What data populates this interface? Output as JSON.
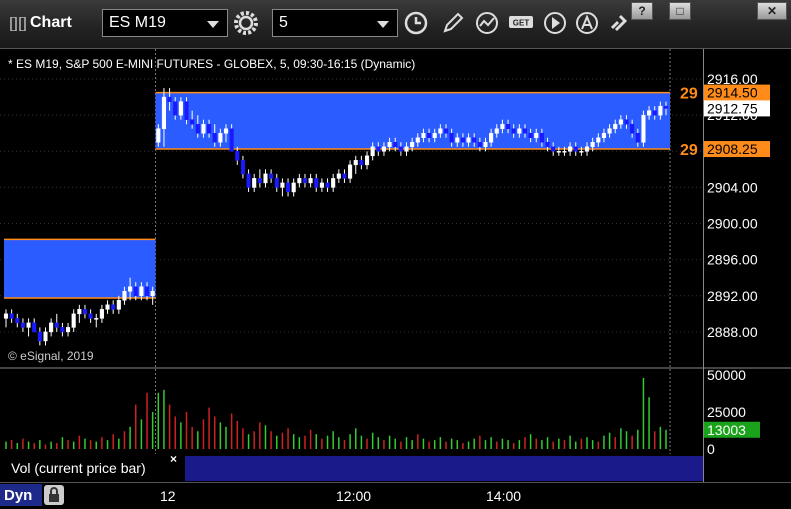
{
  "toolbar": {
    "title": "Chart",
    "symbol": "ES M19",
    "interval": "5"
  },
  "window_buttons": [
    "?",
    "□",
    "✕"
  ],
  "chart_header": "* ES M19, S&P 500 E-MINI FUTURES - GLOBEX, 5, 09:30-16:15 (Dynamic)",
  "copyright": "© eSignal, 2019",
  "price_labels": [
    {
      "value": 2914.5,
      "text": "2914.50",
      "bg": "#ff8c1a",
      "fg": "#000"
    },
    {
      "value": 2912.75,
      "text": "2912.75",
      "bg": "#ffffff",
      "fg": "#000"
    },
    {
      "value": 2908.25,
      "text": "2908.25",
      "bg": "#ff8c1a",
      "fg": "#000"
    }
  ],
  "level_tags": [
    "29",
    "29"
  ],
  "volume_label": {
    "text": "13003",
    "bg": "#1aa31a"
  },
  "vol_pane_label": "Vol (current price bar)",
  "vol_close": "×",
  "dyn_label": "Dyn",
  "time_labels": [
    "12",
    "12:00",
    "14:00"
  ],
  "colors": {
    "zone": "#2a5cff",
    "level_line": "#ff8c1a",
    "candle_up": "#ffffff",
    "candle_down": "#1a1aff",
    "vol_up": "#33cc33",
    "vol_down": "#cc2222"
  },
  "chart_data": {
    "type": "candlestick",
    "ylim": [
      2885,
      2918
    ],
    "yticks": [
      "2916.00",
      "2912.00",
      "2908.00",
      "2904.00",
      "2900.00",
      "2896.00",
      "2892.00",
      "2888.00"
    ],
    "ytick_values": [
      2916,
      2912,
      2908,
      2904,
      2900,
      2896,
      2892,
      2888
    ],
    "zones": [
      {
        "from_index": 0,
        "to_index": 27,
        "low": 2891.75,
        "high": 2898.25
      },
      {
        "from_index": 27,
        "to_index": 127,
        "low": 2908.25,
        "high": 2914.5
      }
    ],
    "vol_ylim": [
      0,
      50000
    ],
    "vol_yticks": [
      "50000",
      "25000",
      "0"
    ],
    "vol_ytick_values": [
      50000,
      25000,
      0
    ],
    "session_break_index": 27,
    "candles": [
      [
        2889.5,
        2890.5,
        2888.5,
        2890.0
      ],
      [
        2890.0,
        2890.5,
        2889.0,
        2889.5
      ],
      [
        2889.5,
        2890.0,
        2888.5,
        2889.0
      ],
      [
        2889.0,
        2889.5,
        2888.0,
        2888.5
      ],
      [
        2888.5,
        2889.5,
        2887.5,
        2889.0
      ],
      [
        2889.0,
        2889.5,
        2888.0,
        2888.0
      ],
      [
        2888.0,
        2888.5,
        2886.5,
        2887.0
      ],
      [
        2887.0,
        2888.5,
        2886.5,
        2888.0
      ],
      [
        2888.0,
        2889.5,
        2887.5,
        2889.0
      ],
      [
        2889.0,
        2890.0,
        2888.0,
        2888.5
      ],
      [
        2888.5,
        2889.0,
        2887.5,
        2888.0
      ],
      [
        2888.0,
        2889.0,
        2887.5,
        2888.5
      ],
      [
        2888.5,
        2890.5,
        2888.0,
        2890.0
      ],
      [
        2890.0,
        2891.0,
        2889.0,
        2890.5
      ],
      [
        2890.5,
        2891.0,
        2889.5,
        2890.0
      ],
      [
        2890.0,
        2890.5,
        2889.0,
        2889.5
      ],
      [
        2889.5,
        2890.0,
        2888.5,
        2889.5
      ],
      [
        2889.5,
        2891.0,
        2889.0,
        2890.5
      ],
      [
        2890.5,
        2891.5,
        2890.0,
        2891.0
      ],
      [
        2891.0,
        2891.5,
        2890.0,
        2890.5
      ],
      [
        2890.5,
        2892.0,
        2890.0,
        2891.5
      ],
      [
        2891.5,
        2893.0,
        2891.0,
        2892.5
      ],
      [
        2892.5,
        2894.0,
        2891.5,
        2893.0
      ],
      [
        2893.0,
        2893.5,
        2891.5,
        2892.0
      ],
      [
        2892.0,
        2893.5,
        2891.5,
        2893.0
      ],
      [
        2893.0,
        2893.5,
        2891.5,
        2892.0
      ],
      [
        2892.0,
        2893.0,
        2891.0,
        2892.5
      ],
      [
        2909.0,
        2911.0,
        2908.5,
        2910.5
      ],
      [
        2910.5,
        2915.0,
        2908.5,
        2914.0
      ],
      [
        2914.0,
        2915.0,
        2912.5,
        2913.5
      ],
      [
        2913.5,
        2914.0,
        2911.5,
        2912.0
      ],
      [
        2912.0,
        2914.0,
        2911.5,
        2913.5
      ],
      [
        2913.5,
        2914.0,
        2911.0,
        2911.5
      ],
      [
        2911.5,
        2912.5,
        2910.5,
        2911.0
      ],
      [
        2911.0,
        2912.0,
        2909.5,
        2910.0
      ],
      [
        2910.0,
        2911.5,
        2909.5,
        2911.0
      ],
      [
        2911.0,
        2911.5,
        2909.5,
        2910.0
      ],
      [
        2910.0,
        2911.0,
        2908.5,
        2909.0
      ],
      [
        2909.0,
        2910.5,
        2908.5,
        2910.0
      ],
      [
        2910.0,
        2911.0,
        2909.0,
        2910.5
      ],
      [
        2910.5,
        2911.0,
        2908.0,
        2908.0
      ],
      [
        2908.0,
        2908.5,
        2906.5,
        2907.0
      ],
      [
        2907.0,
        2907.5,
        2905.0,
        2905.5
      ],
      [
        2905.5,
        2906.0,
        2903.5,
        2904.0
      ],
      [
        2904.0,
        2905.5,
        2903.5,
        2905.0
      ],
      [
        2905.0,
        2906.0,
        2904.0,
        2904.5
      ],
      [
        2904.5,
        2906.0,
        2904.0,
        2905.5
      ],
      [
        2905.5,
        2906.0,
        2904.5,
        2905.0
      ],
      [
        2905.0,
        2905.5,
        2903.5,
        2904.0
      ],
      [
        2904.0,
        2905.0,
        2903.0,
        2904.5
      ],
      [
        2904.5,
        2905.0,
        2903.0,
        2903.5
      ],
      [
        2903.5,
        2905.0,
        2903.0,
        2904.5
      ],
      [
        2904.5,
        2905.5,
        2904.0,
        2905.0
      ],
      [
        2905.0,
        2905.5,
        2904.0,
        2904.5
      ],
      [
        2904.5,
        2905.5,
        2904.0,
        2905.0
      ],
      [
        2905.0,
        2905.5,
        2903.5,
        2904.0
      ],
      [
        2904.0,
        2905.0,
        2903.5,
        2904.5
      ],
      [
        2904.5,
        2905.0,
        2903.5,
        2904.0
      ],
      [
        2904.0,
        2905.5,
        2903.5,
        2905.0
      ],
      [
        2905.0,
        2906.0,
        2904.5,
        2905.5
      ],
      [
        2905.5,
        2906.0,
        2904.5,
        2905.0
      ],
      [
        2905.0,
        2907.0,
        2904.5,
        2906.5
      ],
      [
        2906.5,
        2907.5,
        2905.5,
        2907.0
      ],
      [
        2907.0,
        2907.5,
        2906.0,
        2906.5
      ],
      [
        2906.5,
        2908.0,
        2906.0,
        2907.5
      ],
      [
        2907.5,
        2909.0,
        2907.0,
        2908.5
      ],
      [
        2908.5,
        2909.0,
        2907.5,
        2908.0
      ],
      [
        2908.0,
        2909.0,
        2907.5,
        2908.5
      ],
      [
        2908.5,
        2909.5,
        2908.0,
        2909.0
      ],
      [
        2909.0,
        2909.5,
        2908.0,
        2908.5
      ],
      [
        2908.5,
        2909.0,
        2907.5,
        2908.0
      ],
      [
        2908.0,
        2909.0,
        2907.5,
        2908.5
      ],
      [
        2908.5,
        2909.5,
        2908.0,
        2909.0
      ],
      [
        2909.0,
        2910.0,
        2908.5,
        2909.5
      ],
      [
        2909.5,
        2910.5,
        2909.0,
        2910.0
      ],
      [
        2910.0,
        2910.5,
        2909.0,
        2909.5
      ],
      [
        2909.5,
        2910.5,
        2909.0,
        2910.0
      ],
      [
        2910.0,
        2911.0,
        2909.5,
        2910.5
      ],
      [
        2910.5,
        2911.0,
        2909.5,
        2910.0
      ],
      [
        2910.0,
        2910.5,
        2908.5,
        2909.0
      ],
      [
        2909.0,
        2910.0,
        2908.5,
        2909.5
      ],
      [
        2909.5,
        2910.0,
        2908.5,
        2909.0
      ],
      [
        2909.0,
        2910.0,
        2908.5,
        2909.5
      ],
      [
        2909.5,
        2910.0,
        2908.5,
        2909.0
      ],
      [
        2909.0,
        2909.5,
        2908.0,
        2908.5
      ],
      [
        2908.5,
        2909.5,
        2908.0,
        2909.0
      ],
      [
        2909.0,
        2910.5,
        2908.5,
        2910.0
      ],
      [
        2910.0,
        2911.0,
        2909.5,
        2910.5
      ],
      [
        2910.5,
        2911.5,
        2910.0,
        2911.0
      ],
      [
        2911.0,
        2911.5,
        2910.0,
        2910.5
      ],
      [
        2910.5,
        2911.0,
        2909.5,
        2910.0
      ],
      [
        2910.0,
        2911.0,
        2909.5,
        2910.5
      ],
      [
        2910.5,
        2911.0,
        2909.5,
        2910.0
      ],
      [
        2910.0,
        2910.5,
        2909.0,
        2909.5
      ],
      [
        2909.5,
        2910.5,
        2909.0,
        2910.0
      ],
      [
        2910.0,
        2910.5,
        2908.5,
        2909.0
      ],
      [
        2909.0,
        2909.5,
        2908.0,
        2908.5
      ],
      [
        2908.5,
        2909.0,
        2907.5,
        2908.0
      ],
      [
        2908.0,
        2908.5,
        2907.5,
        2908.0
      ],
      [
        2908.0,
        2908.5,
        2907.5,
        2908.0
      ],
      [
        2908.0,
        2909.0,
        2907.5,
        2908.5
      ],
      [
        2908.5,
        2909.0,
        2907.5,
        2908.0
      ],
      [
        2908.0,
        2908.5,
        2907.5,
        2908.0
      ],
      [
        2908.0,
        2909.0,
        2907.5,
        2908.5
      ],
      [
        2908.5,
        2909.5,
        2908.0,
        2909.0
      ],
      [
        2909.0,
        2910.0,
        2908.5,
        2909.5
      ],
      [
        2909.5,
        2910.5,
        2909.0,
        2910.0
      ],
      [
        2910.0,
        2911.0,
        2909.5,
        2910.5
      ],
      [
        2910.5,
        2911.5,
        2910.0,
        2911.0
      ],
      [
        2911.0,
        2912.0,
        2910.5,
        2911.5
      ],
      [
        2911.5,
        2912.0,
        2910.5,
        2911.0
      ],
      [
        2911.0,
        2911.5,
        2909.5,
        2910.0
      ],
      [
        2910.0,
        2910.5,
        2908.5,
        2909.0
      ],
      [
        2909.0,
        2912.5,
        2908.5,
        2912.0
      ],
      [
        2912.0,
        2913.0,
        2911.5,
        2912.5
      ],
      [
        2912.5,
        2913.0,
        2911.5,
        2912.0
      ],
      [
        2912.0,
        2913.5,
        2911.5,
        2913.0
      ],
      [
        2913.0,
        2913.5,
        2912.0,
        2912.75
      ]
    ],
    "volume": [
      [
        5000,
        1
      ],
      [
        6000,
        0
      ],
      [
        4000,
        1
      ],
      [
        7000,
        0
      ],
      [
        5000,
        1
      ],
      [
        4000,
        0
      ],
      [
        6000,
        1
      ],
      [
        3000,
        0
      ],
      [
        5000,
        1
      ],
      [
        4000,
        0
      ],
      [
        8000,
        1
      ],
      [
        6000,
        0
      ],
      [
        5000,
        1
      ],
      [
        9000,
        0
      ],
      [
        7000,
        1
      ],
      [
        6000,
        0
      ],
      [
        5000,
        1
      ],
      [
        8000,
        0
      ],
      [
        6000,
        1
      ],
      [
        10000,
        0
      ],
      [
        7000,
        1
      ],
      [
        12000,
        0
      ],
      [
        15000,
        1
      ],
      [
        30000,
        0
      ],
      [
        20000,
        1
      ],
      [
        38000,
        0
      ],
      [
        25000,
        1
      ],
      [
        38000,
        1
      ],
      [
        40000,
        1
      ],
      [
        30000,
        0
      ],
      [
        22000,
        0
      ],
      [
        18000,
        1
      ],
      [
        25000,
        0
      ],
      [
        15000,
        0
      ],
      [
        12000,
        1
      ],
      [
        20000,
        0
      ],
      [
        28000,
        0
      ],
      [
        22000,
        0
      ],
      [
        18000,
        1
      ],
      [
        15000,
        1
      ],
      [
        24000,
        0
      ],
      [
        19000,
        0
      ],
      [
        14000,
        0
      ],
      [
        10000,
        1
      ],
      [
        12000,
        0
      ],
      [
        18000,
        0
      ],
      [
        16000,
        1
      ],
      [
        12000,
        0
      ],
      [
        9000,
        1
      ],
      [
        11000,
        0
      ],
      [
        14000,
        0
      ],
      [
        10000,
        1
      ],
      [
        8000,
        1
      ],
      [
        9000,
        0
      ],
      [
        13000,
        0
      ],
      [
        10000,
        1
      ],
      [
        7000,
        0
      ],
      [
        9000,
        1
      ],
      [
        12000,
        1
      ],
      [
        8000,
        1
      ],
      [
        6000,
        0
      ],
      [
        10000,
        1
      ],
      [
        14000,
        1
      ],
      [
        9000,
        1
      ],
      [
        7000,
        0
      ],
      [
        11000,
        1
      ],
      [
        8000,
        1
      ],
      [
        6000,
        0
      ],
      [
        9000,
        1
      ],
      [
        7000,
        1
      ],
      [
        5000,
        0
      ],
      [
        8000,
        1
      ],
      [
        6000,
        1
      ],
      [
        10000,
        0
      ],
      [
        7000,
        1
      ],
      [
        5000,
        0
      ],
      [
        6000,
        1
      ],
      [
        8000,
        1
      ],
      [
        5000,
        0
      ],
      [
        7000,
        1
      ],
      [
        6000,
        1
      ],
      [
        4000,
        0
      ],
      [
        5000,
        1
      ],
      [
        7000,
        1
      ],
      [
        9000,
        0
      ],
      [
        6000,
        1
      ],
      [
        8000,
        1
      ],
      [
        5000,
        0
      ],
      [
        7000,
        1
      ],
      [
        6000,
        1
      ],
      [
        4000,
        0
      ],
      [
        6000,
        1
      ],
      [
        8000,
        0
      ],
      [
        10000,
        1
      ],
      [
        7000,
        0
      ],
      [
        6000,
        1
      ],
      [
        8000,
        1
      ],
      [
        5000,
        0
      ],
      [
        7000,
        1
      ],
      [
        6000,
        0
      ],
      [
        9000,
        1
      ],
      [
        5000,
        1
      ],
      [
        7000,
        0
      ],
      [
        8000,
        1
      ],
      [
        6000,
        1
      ],
      [
        5000,
        0
      ],
      [
        9000,
        1
      ],
      [
        11000,
        1
      ],
      [
        8000,
        0
      ],
      [
        14000,
        1
      ],
      [
        12000,
        1
      ],
      [
        9000,
        0
      ],
      [
        13000,
        1
      ],
      [
        48000,
        1
      ],
      [
        35000,
        1
      ],
      [
        12000,
        0
      ],
      [
        15000,
        1
      ],
      [
        13003,
        1
      ]
    ]
  }
}
